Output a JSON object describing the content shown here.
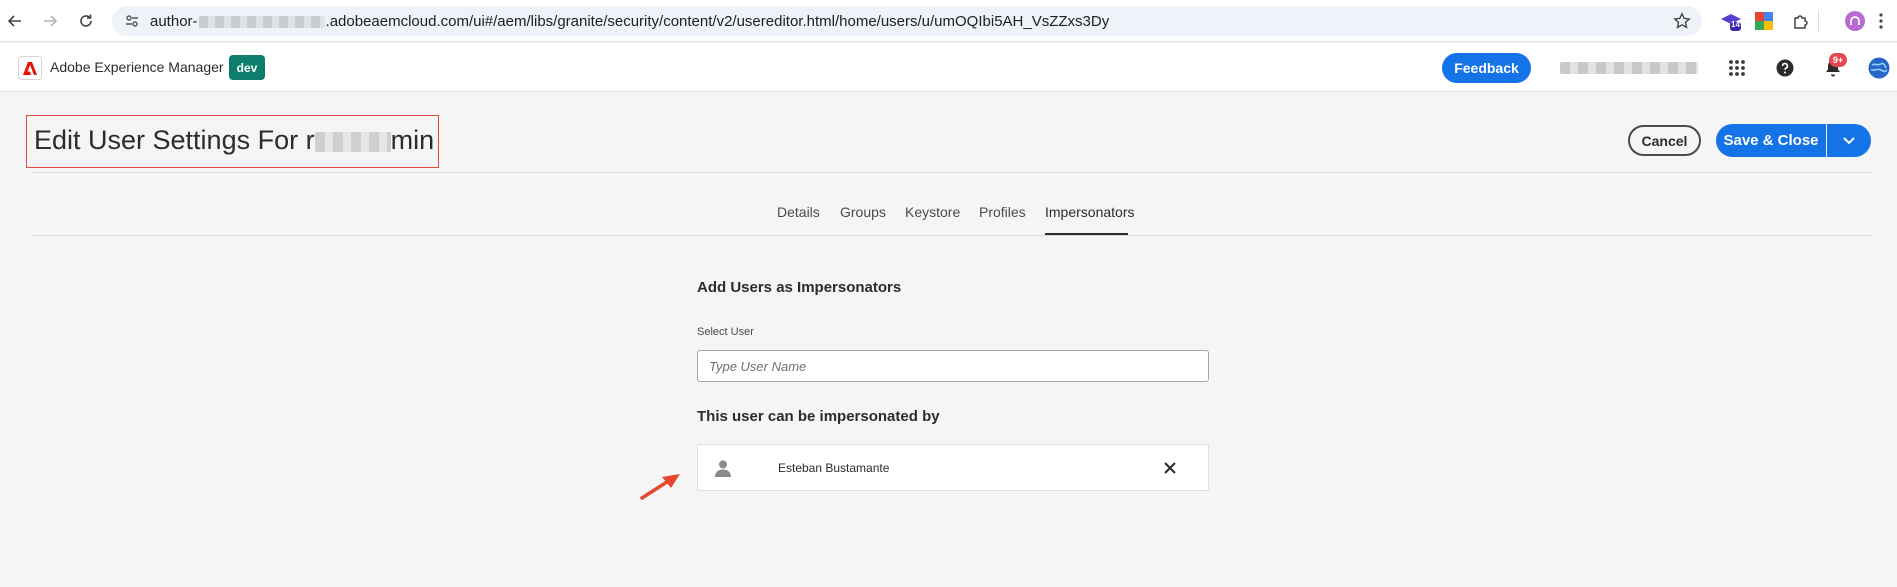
{
  "browser": {
    "url_prefix": "author-",
    "url_suffix": ".adobeaemcloud.com/ui#/aem/libs/granite/security/content/v2/usereditor.html/home/users/u/umOQIbi5AH_VsZZxs3Dy",
    "extension_badge": "14"
  },
  "header": {
    "app_name": "Adobe Experience Manager",
    "env_badge": "dev",
    "feedback_label": "Feedback",
    "notification_count": "9+"
  },
  "page": {
    "title_prefix": "Edit User Settings For r",
    "title_suffix": "min",
    "cancel_label": "Cancel",
    "save_label": "Save & Close"
  },
  "tabs": [
    {
      "label": "Details"
    },
    {
      "label": "Groups"
    },
    {
      "label": "Keystore"
    },
    {
      "label": "Profiles"
    },
    {
      "label": "Impersonators"
    }
  ],
  "impersonators": {
    "heading": "Add Users as Impersonators",
    "field_label": "Select User",
    "placeholder": "Type User Name",
    "list_heading": "This user can be impersonated by",
    "users": [
      {
        "name": "Esteban Bustamante"
      }
    ]
  },
  "colors": {
    "accent": "#1473e6",
    "env_badge": "#0d7d6c",
    "annotation": "#e04a3f"
  }
}
